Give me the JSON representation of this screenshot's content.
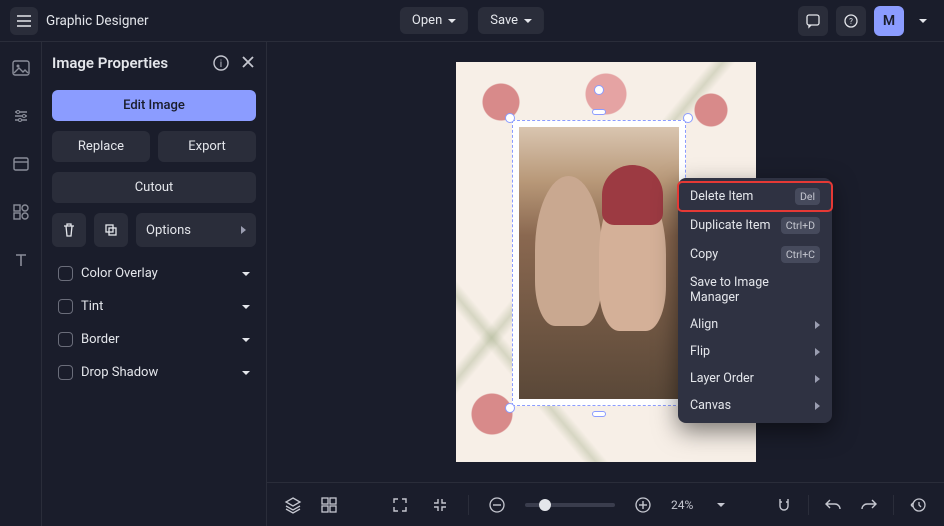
{
  "app": {
    "title": "Graphic Designer"
  },
  "topbar": {
    "open_label": "Open",
    "save_label": "Save",
    "avatar_letter": "M"
  },
  "panel": {
    "title": "Image Properties",
    "edit_label": "Edit Image",
    "replace_label": "Replace",
    "export_label": "Export",
    "cutout_label": "Cutout",
    "options_label": "Options",
    "accordion": [
      {
        "label": "Color Overlay"
      },
      {
        "label": "Tint"
      },
      {
        "label": "Border"
      },
      {
        "label": "Drop Shadow"
      }
    ]
  },
  "context_menu": {
    "items": [
      {
        "label": "Delete Item",
        "shortcut": "Del",
        "highlighted": true
      },
      {
        "label": "Duplicate Item",
        "shortcut": "Ctrl+D"
      },
      {
        "label": "Copy",
        "shortcut": "Ctrl+C"
      },
      {
        "label": "Save to Image Manager"
      },
      {
        "label": "Align",
        "submenu": true
      },
      {
        "label": "Flip",
        "submenu": true
      },
      {
        "label": "Layer Order",
        "submenu": true
      },
      {
        "label": "Canvas",
        "submenu": true
      }
    ]
  },
  "bottombar": {
    "zoom_label": "24%"
  },
  "colors": {
    "accent": "#8b9cff",
    "highlight": "#e53935"
  }
}
